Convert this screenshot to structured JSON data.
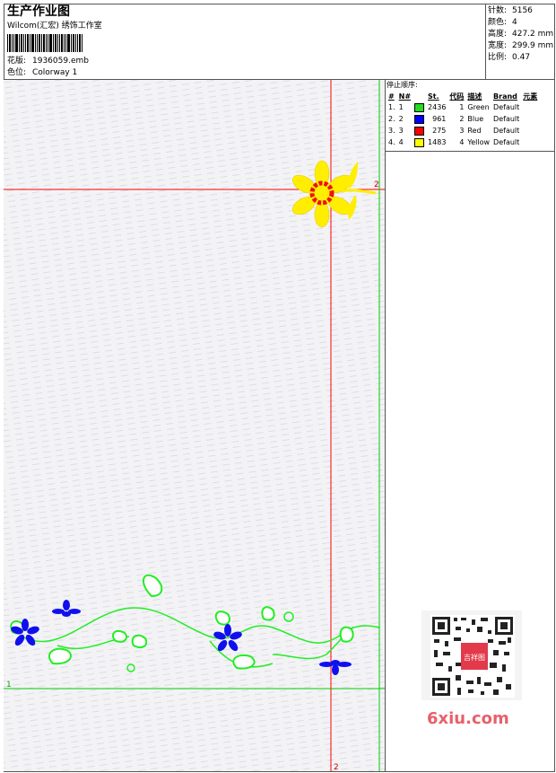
{
  "header": {
    "title": "生产作业图",
    "company": "Wilcom(汇宏) 绣饰工作室",
    "design_label": "花版:",
    "design_value": "1936059.emb",
    "colorway_label": "色位:",
    "colorway_value": "Colorway 1"
  },
  "stats": [
    {
      "label": "针数:",
      "value": "5156"
    },
    {
      "label": "颜色:",
      "value": "4"
    },
    {
      "label": "高度:",
      "value": "427.2 mm"
    },
    {
      "label": "宽度:",
      "value": "299.9 mm"
    },
    {
      "label": "比例:",
      "value": "0.47"
    }
  ],
  "stop_sequence": {
    "title": "停止顺序:",
    "columns": [
      "#",
      "N#",
      "St.",
      "代码",
      "描述",
      "Brand",
      "元素"
    ],
    "rows": [
      {
        "num": "1.",
        "n": "1",
        "color": "#22dd22",
        "st": "2436",
        "code": "1",
        "desc": "Green",
        "brand": "Default"
      },
      {
        "num": "2.",
        "n": "2",
        "color": "#0000ff",
        "st": "961",
        "code": "2",
        "desc": "Blue",
        "brand": "Default"
      },
      {
        "num": "3.",
        "n": "3",
        "color": "#ff0000",
        "st": "275",
        "code": "3",
        "desc": "Red",
        "brand": "Default"
      },
      {
        "num": "4.",
        "n": "4",
        "color": "#ffff00",
        "st": "1483",
        "code": "4",
        "desc": "Yellow",
        "brand": "Default"
      }
    ]
  },
  "guides": {
    "horizontal_top_label": "2",
    "horizontal_bottom_label": "1",
    "vertical_label": "2"
  },
  "watermark": {
    "text": "6xiu.com",
    "seal_text": "吉祥图"
  },
  "colors": {
    "guide_red": "#ff0000",
    "guide_green": "#00cc00",
    "stitch_green": "#22ee22",
    "stitch_blue": "#1010ee",
    "stitch_red": "#ee1111",
    "stitch_yellow": "#ffee00"
  }
}
